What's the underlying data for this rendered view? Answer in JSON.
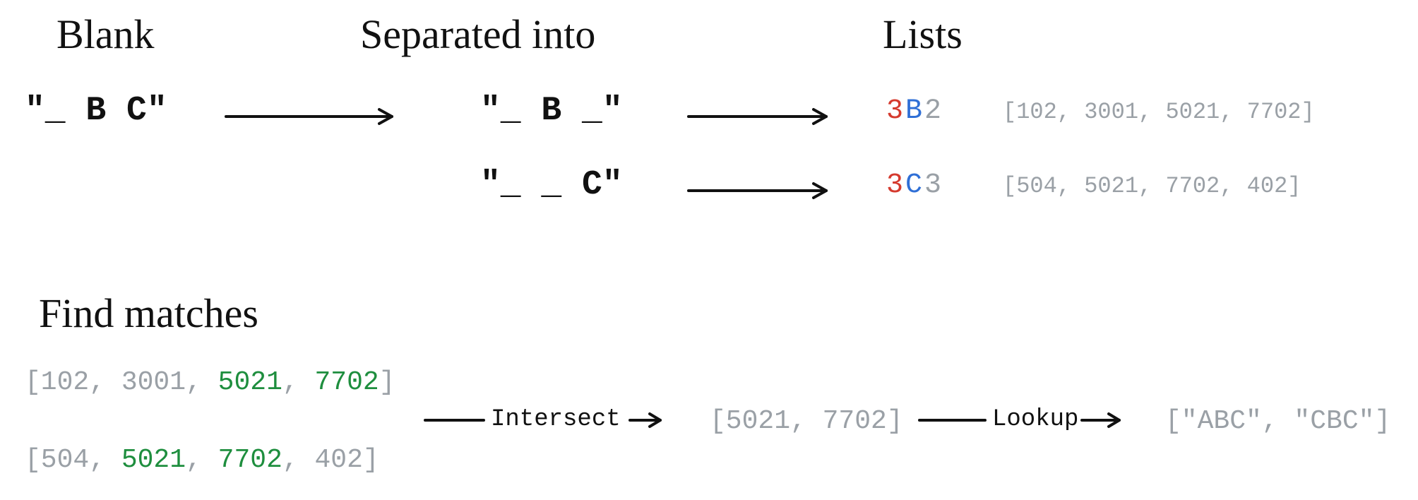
{
  "headings": {
    "blank": "Blank",
    "separated": "Separated into",
    "lists": "Lists",
    "find_matches": "Find matches"
  },
  "blank_input": "\"_ B C\"",
  "separated": {
    "row1": "\"_ B _\"",
    "row2": "\"_ _ C\""
  },
  "codes": {
    "row1": {
      "a": "3",
      "b": "B",
      "c": "2"
    },
    "row2": {
      "a": "3",
      "b": "C",
      "c": "3"
    }
  },
  "lists": {
    "row1_text": "[102, 3001, 5021, 7702]",
    "row2_text": "[504, 5021, 7702, 402]"
  },
  "match_section": {
    "listA": {
      "p0": "[102, ",
      "p1": "3001, ",
      "p2": "5021",
      "p3": ", ",
      "p4": "7702",
      "p5": "]"
    },
    "listB": {
      "p0": "[504, ",
      "p1": "5021",
      "p2": ", ",
      "p3": "7702",
      "p4": ", 402]"
    },
    "op1": "Intersect",
    "intersect_result": "[5021, 7702]",
    "op2": "Lookup",
    "lookup_result": "[\"ABC\", \"CBC\"]"
  }
}
